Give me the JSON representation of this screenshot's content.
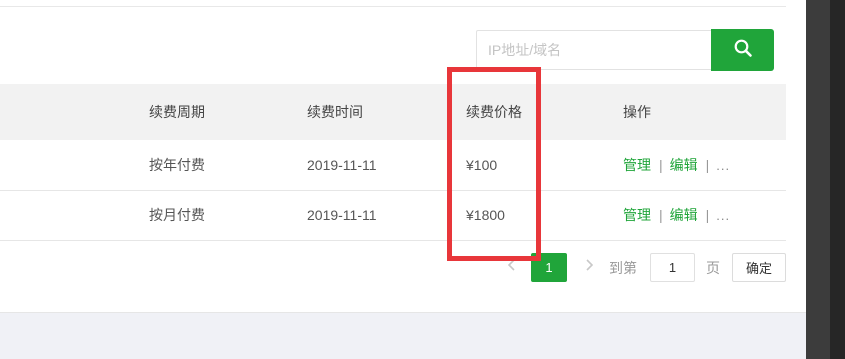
{
  "search": {
    "placeholder": "IP地址/域名",
    "icon": "search-icon"
  },
  "table": {
    "columns": [
      "续费周期",
      "续费时间",
      "续费价格",
      "操作"
    ],
    "rows": [
      {
        "period": "按年付费",
        "date": "2019-11-11",
        "price": "¥100",
        "actions": {
          "manage": "管理",
          "edit": "编辑",
          "more": "..."
        }
      },
      {
        "period": "按月付费",
        "date": "2019-11-11",
        "price": "¥1800",
        "actions": {
          "manage": "管理",
          "edit": "编辑",
          "more": "..."
        }
      }
    ],
    "separator": "|"
  },
  "pagination": {
    "current_page": "1",
    "goto_label": "到第",
    "goto_value": "1",
    "page_label": "页",
    "confirm_label": "确定"
  },
  "colors": {
    "accent": "#20a53a",
    "highlight": "#e8363a"
  }
}
